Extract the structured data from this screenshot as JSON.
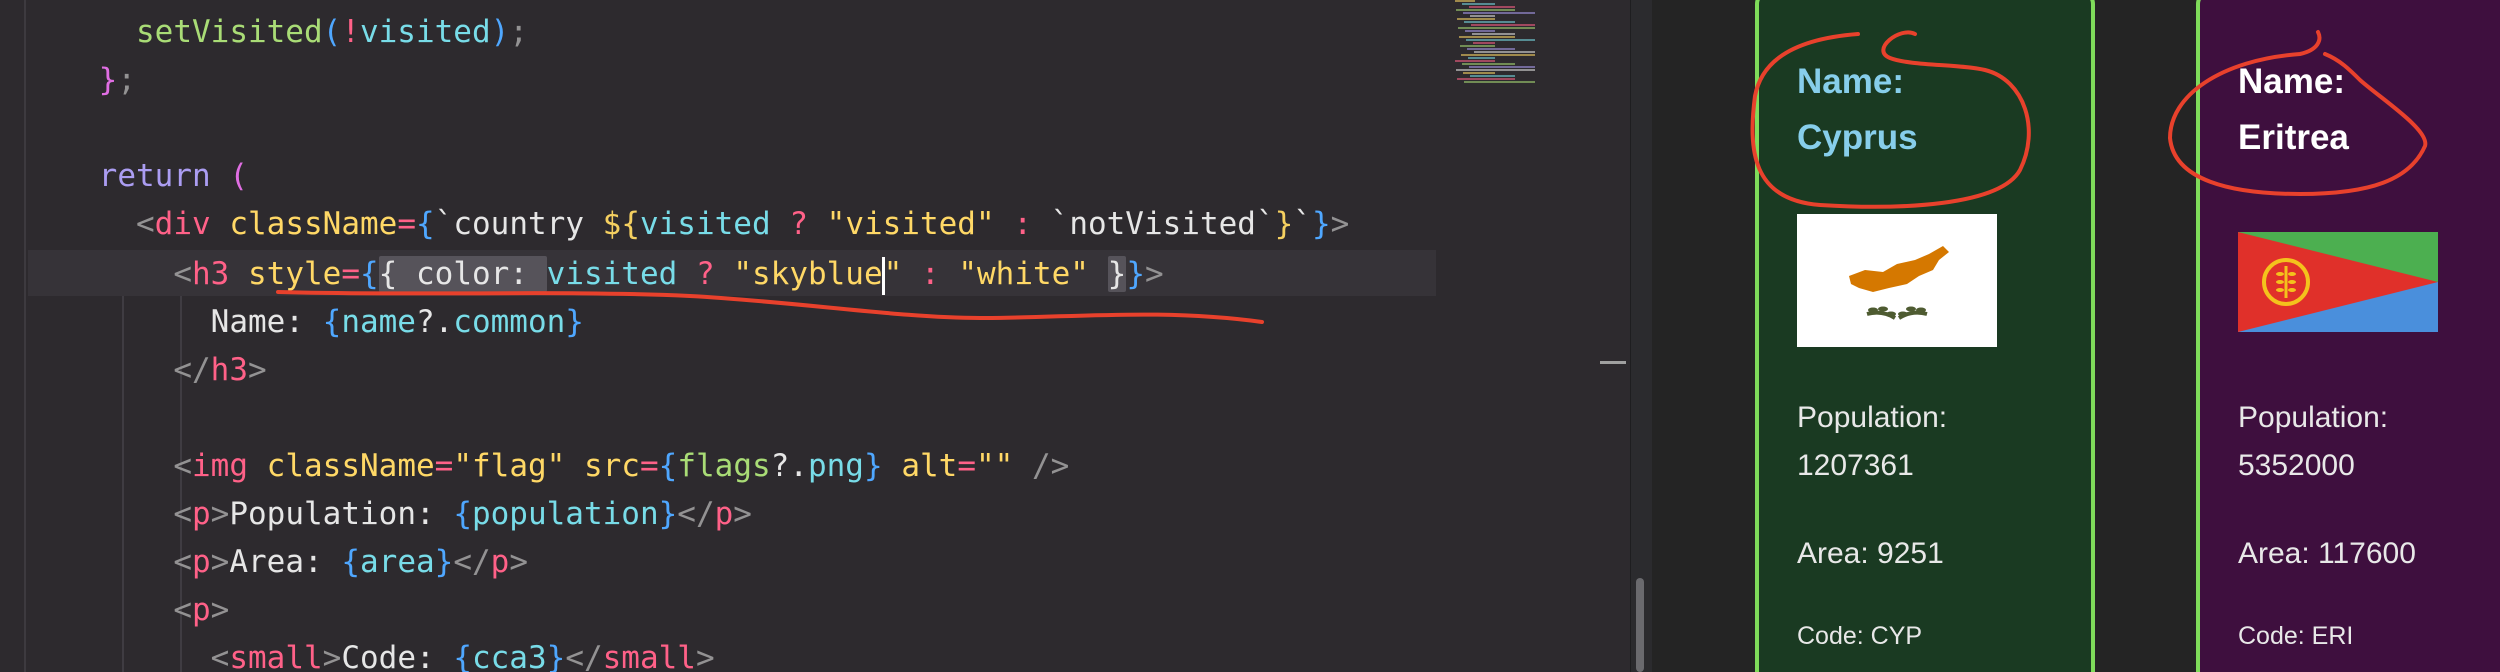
{
  "editor": {
    "lines": [
      {
        "indent": "   ",
        "tokens": [
          [
            "fn",
            "setVisited"
          ],
          [
            "br3",
            "("
          ],
          [
            "op",
            "!"
          ],
          [
            "var",
            "visited"
          ],
          [
            "br3",
            ")"
          ],
          [
            "pn",
            ";"
          ]
        ]
      },
      {
        "indent": " ",
        "tokens": [
          [
            "br2",
            "}"
          ],
          [
            "pn",
            ";"
          ]
        ]
      },
      {
        "indent": "",
        "tokens": []
      },
      {
        "indent": " ",
        "tokens": [
          [
            "kw2",
            "return"
          ],
          [
            "txt",
            " "
          ],
          [
            "br2",
            "("
          ]
        ]
      },
      {
        "indent": "   ",
        "tokens": [
          [
            "pn",
            "<"
          ],
          [
            "tag",
            "div"
          ],
          [
            "txt",
            " "
          ],
          [
            "attr",
            "className"
          ],
          [
            "op",
            "="
          ],
          [
            "br3",
            "{"
          ],
          [
            "tpl",
            "`country "
          ],
          [
            "br1",
            "${"
          ],
          [
            "var",
            "visited"
          ],
          [
            "txt",
            " "
          ],
          [
            "op",
            "?"
          ],
          [
            "txt",
            " "
          ],
          [
            "str",
            "\"visited\""
          ],
          [
            "txt",
            " "
          ],
          [
            "op",
            ":"
          ],
          [
            "txt",
            " "
          ],
          [
            "tpl",
            "`notVisited`"
          ],
          [
            "br1",
            "}"
          ],
          [
            "tpl",
            "`"
          ],
          [
            "br3",
            "}"
          ],
          [
            "pn",
            ">"
          ]
        ]
      },
      {
        "indent": "     ",
        "tokens": [
          [
            "pn",
            "<"
          ],
          [
            "tag",
            "h3"
          ],
          [
            "txt",
            " "
          ],
          [
            "attr",
            "style"
          ],
          [
            "op",
            "="
          ],
          [
            "br3",
            "{"
          ],
          [
            "sel",
            "{ color: "
          ],
          [
            "var",
            "visited"
          ],
          [
            "txt",
            " "
          ],
          [
            "op",
            "?"
          ],
          [
            "txt",
            " "
          ],
          [
            "str",
            "\"skyblue"
          ],
          [
            "caret",
            ""
          ],
          [
            "str",
            "\""
          ],
          [
            "txt",
            " "
          ],
          [
            "op",
            ":"
          ],
          [
            "txt",
            " "
          ],
          [
            "str",
            "\"white\""
          ],
          [
            "txt",
            " "
          ],
          [
            "sel",
            "}"
          ],
          [
            "br3",
            "}"
          ],
          [
            "pn",
            ">"
          ]
        ]
      },
      {
        "indent": "       ",
        "tokens": [
          [
            "txt",
            "Name: "
          ],
          [
            "br3",
            "{"
          ],
          [
            "var",
            "name"
          ],
          [
            "txt",
            "?."
          ],
          [
            "var",
            "common"
          ],
          [
            "br3",
            "}"
          ]
        ]
      },
      {
        "indent": "     ",
        "tokens": [
          [
            "pn",
            "</"
          ],
          [
            "tag",
            "h3"
          ],
          [
            "pn",
            ">"
          ]
        ]
      },
      {
        "indent": "",
        "tokens": []
      },
      {
        "indent": "     ",
        "tokens": [
          [
            "pn",
            "<"
          ],
          [
            "tag",
            "img"
          ],
          [
            "txt",
            " "
          ],
          [
            "attr",
            "className"
          ],
          [
            "op",
            "="
          ],
          [
            "str",
            "\"flag\""
          ],
          [
            "txt",
            " "
          ],
          [
            "attr",
            "src"
          ],
          [
            "op",
            "="
          ],
          [
            "br3",
            "{"
          ],
          [
            "fn",
            "flags"
          ],
          [
            "txt",
            "?."
          ],
          [
            "var",
            "png"
          ],
          [
            "br3",
            "}"
          ],
          [
            "txt",
            " "
          ],
          [
            "attr",
            "alt"
          ],
          [
            "op",
            "="
          ],
          [
            "str",
            "\"\""
          ],
          [
            "txt",
            " "
          ],
          [
            "pn",
            "/>"
          ]
        ]
      },
      {
        "indent": "     ",
        "tokens": [
          [
            "pn",
            "<"
          ],
          [
            "tag",
            "p"
          ],
          [
            "pn",
            ">"
          ],
          [
            "txt",
            "Population: "
          ],
          [
            "br3",
            "{"
          ],
          [
            "var",
            "population"
          ],
          [
            "br3",
            "}"
          ],
          [
            "pn",
            "</"
          ],
          [
            "tag",
            "p"
          ],
          [
            "pn",
            ">"
          ]
        ]
      },
      {
        "indent": "     ",
        "tokens": [
          [
            "pn",
            "<"
          ],
          [
            "tag",
            "p"
          ],
          [
            "pn",
            ">"
          ],
          [
            "txt",
            "Area: "
          ],
          [
            "br3",
            "{"
          ],
          [
            "var",
            "area"
          ],
          [
            "br3",
            "}"
          ],
          [
            "pn",
            "</"
          ],
          [
            "tag",
            "p"
          ],
          [
            "pn",
            ">"
          ]
        ]
      },
      {
        "indent": "     ",
        "tokens": [
          [
            "pn",
            "<"
          ],
          [
            "tag",
            "p"
          ],
          [
            "pn",
            ">"
          ]
        ]
      },
      {
        "indent": "       ",
        "tokens": [
          [
            "pn",
            "<"
          ],
          [
            "tag",
            "small"
          ],
          [
            "pn",
            ">"
          ],
          [
            "txt",
            "Code: "
          ],
          [
            "br3",
            "{"
          ],
          [
            "var",
            "cca3"
          ],
          [
            "br3",
            "}"
          ],
          [
            "pn",
            "</"
          ],
          [
            "tag",
            "small"
          ],
          [
            "pn",
            ">"
          ]
        ]
      }
    ]
  },
  "preview": {
    "cards": [
      {
        "name_label": "Name:",
        "name_value": "Cyprus",
        "population_label": "Population:",
        "population_value": "1207361",
        "area_text": "Area: 9251",
        "code_text": "Code: CYP",
        "visited": true,
        "background": "#1a3a22",
        "title_color": "#87ceeb",
        "flag_icon": "cyprus-flag-icon"
      },
      {
        "name_label": "Name:",
        "name_value": "Eritrea",
        "population_label": "Population:",
        "population_value": "5352000",
        "area_text": "Area: 117600",
        "code_text": "Code: ERI",
        "visited": false,
        "background": "#3e0f3e",
        "title_color": "#ffffff",
        "flag_icon": "eritrea-flag-icon"
      }
    ]
  },
  "colors": {
    "annotation": "#e8412c",
    "card_border": "#7fdc5a"
  }
}
